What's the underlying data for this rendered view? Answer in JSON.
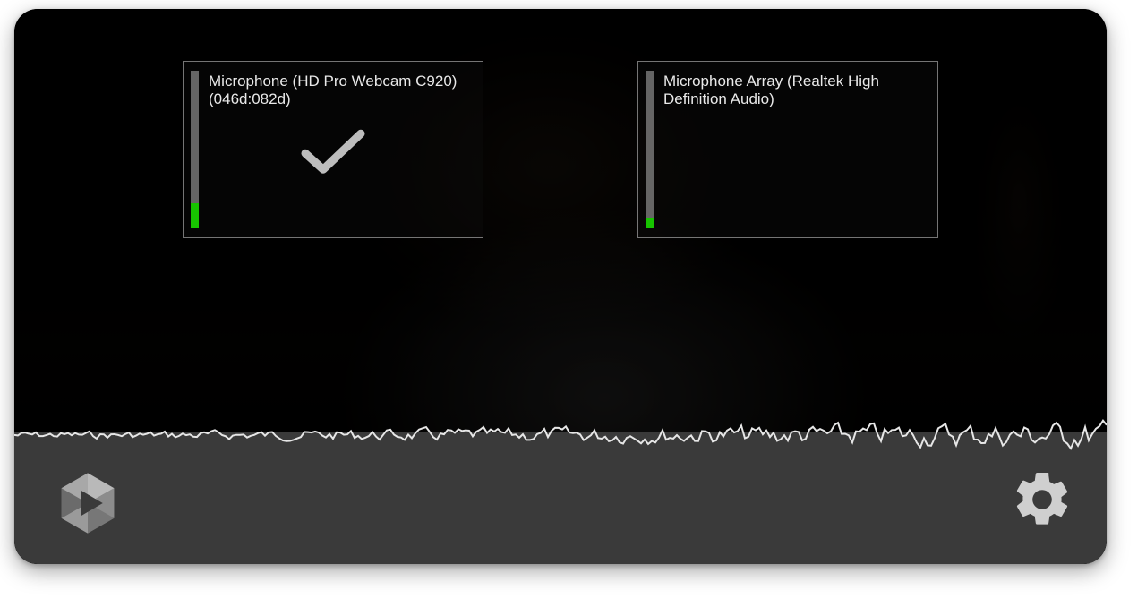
{
  "mic_cards": [
    {
      "label": "Microphone (HD Pro Webcam C920) (046d:082d)",
      "selected": true,
      "level_percent": 16
    },
    {
      "label": "Microphone Array (Realtek High Definition Audio)",
      "selected": false,
      "level_percent": 6
    }
  ],
  "colors": {
    "meter_fill": "#17c400",
    "icon": "#cfcfcf",
    "bottom_bar": "#3a3a3a"
  },
  "icons": {
    "check": "checkmark-icon",
    "logo": "clipchamp-logo-icon",
    "settings": "gear-icon"
  }
}
